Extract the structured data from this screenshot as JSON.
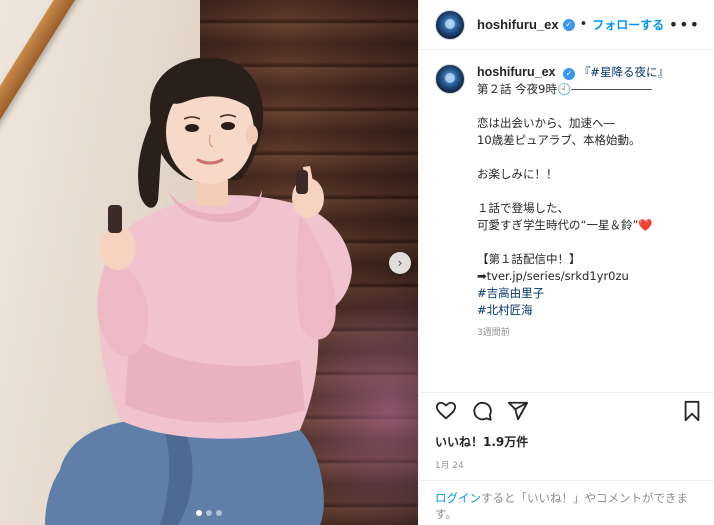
{
  "post": {
    "username": "hoshifuru_ex",
    "separator": "•",
    "follow_label": "フォローする",
    "more_label": "•••",
    "verified_mark": "✓"
  },
  "caption": {
    "username": "hoshifuru_ex",
    "title_hashtag": "『#星降る夜に』",
    "episode_line": "第２話 今夜9時🕘―――――――",
    "lines": [
      "",
      "恋は出会いから、加速へ―",
      "10歳差ピュアラブ、本格始動。",
      "",
      "お楽しみに！！",
      "",
      "１話で登場した、",
      "可愛すぎ学生時代の“一星＆鈴”❤️",
      "",
      "【第１話配信中！】",
      "➡tver.jp/series/srkd1yr0zu",
      ""
    ],
    "hashtags": [
      "#吉高由里子",
      "#北村匠海"
    ],
    "time_ago": "3週間前"
  },
  "engagement": {
    "likes": "いいね！1.9万件",
    "date": "1月 24"
  },
  "login_bar": {
    "login_link": "ログイン",
    "rest_text": "すると「いいね！」やコメントができます。"
  },
  "carousel": {
    "next_icon": "›",
    "slide_count": 3,
    "active_index": 0
  },
  "icons": [
    "heart-icon",
    "comment-icon",
    "share-icon",
    "bookmark-icon"
  ]
}
